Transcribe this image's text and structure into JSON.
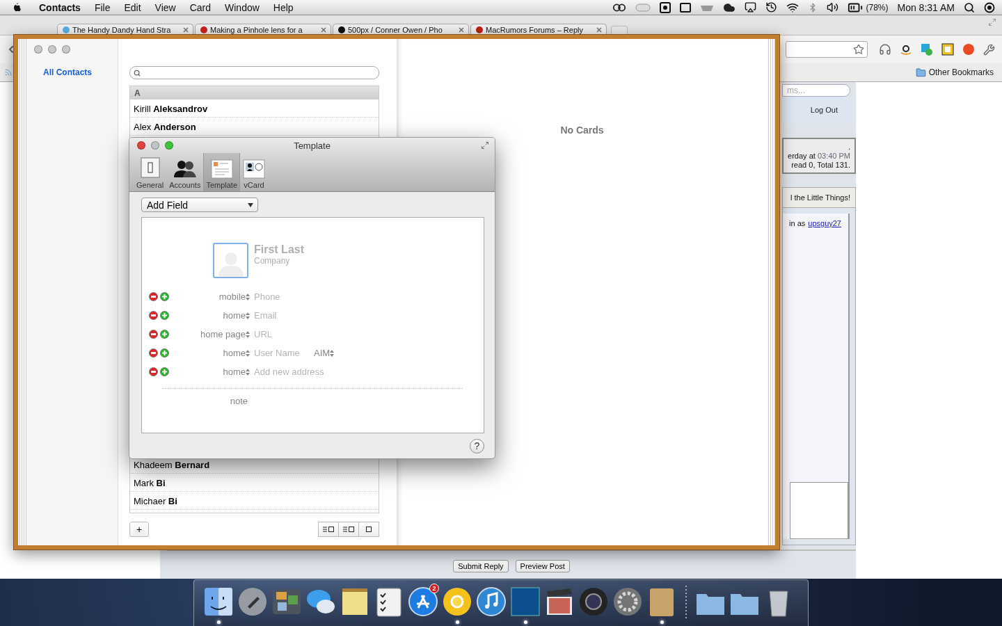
{
  "menu_bar": {
    "app_name": "Contacts",
    "menus": [
      "File",
      "Edit",
      "View",
      "Card",
      "Window",
      "Help"
    ],
    "battery": "(78%)",
    "clock": "Mon 8:31 AM"
  },
  "browser": {
    "tabs": [
      {
        "title": "The Handy Dandy Hand Stra"
      },
      {
        "title": "Making a Pinhole lens for a"
      },
      {
        "title": "500px / Conner Owen / Pho"
      },
      {
        "title": "MacRumors Forums – Reply"
      }
    ],
    "bookmarks": [
      "Other Bookmarks"
    ],
    "page": {
      "search_placeholder": "ms...",
      "logout": "Log Out",
      "welcome": ".",
      "last_visit": "erday at",
      "last_visit_time": "03:40 PM",
      "messages": "read 0, Total 131.",
      "forum_title": "l the Little Things!",
      "logged_in": "in as",
      "username": "upsguy27",
      "buttons": [
        "Submit Reply",
        "Preview Post"
      ]
    }
  },
  "contacts": {
    "sidebar": [
      {
        "label": "All Contacts",
        "selected": true
      }
    ],
    "list_header": "A",
    "rows_top": [
      "Kirill **Aleksandrov**",
      "Alex **Anderson**"
    ],
    "rows_bottom": [
      "Khadeem **Bernard**",
      "Mark **Bi**",
      "Michaer **Bi**"
    ],
    "add_button": "+",
    "empty_text": "No Cards"
  },
  "dialog": {
    "title": "Template",
    "tabs": [
      {
        "label": "General",
        "kind": "general",
        "selected": false
      },
      {
        "label": "Accounts",
        "kind": "accounts",
        "selected": false
      },
      {
        "label": "Template",
        "kind": "template",
        "selected": true
      },
      {
        "label": "vCard",
        "kind": "vcard",
        "selected": false
      }
    ],
    "add_field": "Add Field",
    "card": {
      "name": {
        "placeholder": "First Last"
      },
      "company": {
        "placeholder": "Company"
      },
      "fields": [
        {
          "label": "mobile",
          "placeholder": "Phone"
        },
        {
          "label": "home",
          "placeholder": "Email"
        },
        {
          "label": "home page",
          "placeholder": "URL"
        },
        {
          "label": "home",
          "placeholder": "User Name",
          "service": "AIM"
        },
        {
          "label": "home",
          "placeholder": "Add new address"
        }
      ],
      "note_label": "note"
    },
    "help": "?"
  },
  "dock": {
    "items": [
      {
        "kind": "finder",
        "running": true
      },
      {
        "kind": "launchpad",
        "running": false
      },
      {
        "kind": "photos",
        "running": false
      },
      {
        "kind": "messages",
        "running": false
      },
      {
        "kind": "stickies",
        "running": false
      },
      {
        "kind": "reminders",
        "running": false
      },
      {
        "kind": "appstore",
        "running": false,
        "badge": "2"
      },
      {
        "kind": "chrome",
        "running": true
      },
      {
        "kind": "itunes",
        "running": false
      },
      {
        "kind": "photoshop",
        "running": true
      },
      {
        "kind": "finalcut",
        "running": false
      },
      {
        "kind": "aperture",
        "running": false
      },
      {
        "kind": "prefs",
        "running": false
      },
      {
        "kind": "addressbook",
        "running": true
      },
      {
        "kind": "separator"
      },
      {
        "kind": "folder",
        "running": false
      },
      {
        "kind": "folder",
        "running": false
      },
      {
        "kind": "trash",
        "running": false
      }
    ]
  }
}
